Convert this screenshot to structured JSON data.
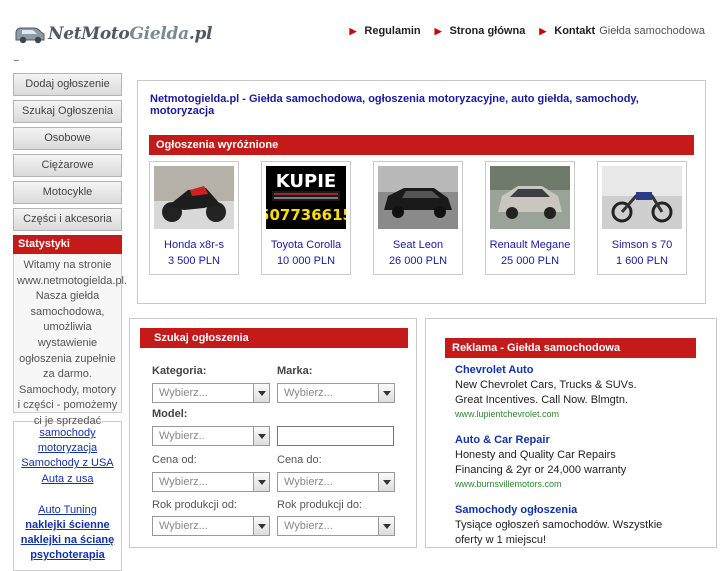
{
  "header": {
    "logo_text_a": "NetMoto",
    "logo_text_b": "Gielda",
    "logo_text_c": ".pl",
    "nav": [
      {
        "label": "Regulamin"
      },
      {
        "label": "Strona główna"
      },
      {
        "label": "Kontakt"
      }
    ],
    "nav_sub": "Giełda samochodowa"
  },
  "sidebar": {
    "buttons": [
      "Dodaj ogłoszenie",
      "Szukaj Ogłoszenia",
      "Osobowe",
      "Ciężarowe",
      "Motocykle",
      "Części i akcesoria"
    ],
    "stats_title": "Statystyki",
    "stats_text": "Witamy na stronie www.netmotogielda.pl. Nasza giełda samochodowa, umożliwia wystawienie ogłoszenia zupełnie za darmo. Samochody, motory i części - pomożemy ci je sprzedać",
    "links": [
      "samochody",
      "motoryzacja",
      "Samochody z USA",
      "Auta z usa",
      "Auto Tuning",
      "naklejki ścienne",
      "naklejki na ścianę",
      "psychoterapia"
    ]
  },
  "main": {
    "title": "Netmotogielda.pl - Giełda samochodowa, ogłoszenia motoryzacyjne, auto giełda, samochody, motoryzacja",
    "featured_title": "Ogłoszenia wyróżnione",
    "cards": [
      {
        "name": "Honda x8r-s",
        "price": "3 500 PLN"
      },
      {
        "name": "Toyota Corolla",
        "price": "10 000 PLN"
      },
      {
        "name": "Seat Leon",
        "price": "26 000 PLN"
      },
      {
        "name": "Renault Megane",
        "price": "25 000 PLN"
      },
      {
        "name": "Simson s 70",
        "price": "1 600 PLN"
      }
    ],
    "kupie": {
      "line1": "KUPIE",
      "line2": "507736615"
    }
  },
  "search": {
    "title": "Szukaj ogłoszenia",
    "kategoria_label": "Kategoria:",
    "marka_label": "Marka:",
    "model_label": "Model:",
    "cena_od_label": "Cena od:",
    "cena_do_label": "Cena do:",
    "rok_od_label": "Rok produkcji od:",
    "rok_do_label": "Rok produkcji do:",
    "kategoria_value": "Wybierz...",
    "marka_value": "Wybierz...",
    "model_value": "Wybierz..",
    "cena_od_value": "Wybierz...",
    "cena_do_value": "Wybierz...",
    "rok_od_value": "Wybierz...",
    "rok_do_value": "Wybierz..."
  },
  "ads": {
    "title": "Reklama - Giełda samochodowa",
    "items": [
      {
        "title": "Chevrolet Auto",
        "desc": "New Chevrolet Cars, Trucks & SUVs. Great Incentives. Call Now. Blmgtn.",
        "url": "www.lupientchevrolet.com"
      },
      {
        "title": "Auto & Car Repair",
        "desc": "Honesty and Quality Car Repairs Financing & 2yr or 24,000 warranty",
        "url": "www.burnsvillemotors.com"
      },
      {
        "title": "Samochody ogłoszenia",
        "desc": "Tysiące ogłoszeń samochodów. Wszystkie oferty w 1 miejscu!",
        "url": ""
      }
    ]
  }
}
